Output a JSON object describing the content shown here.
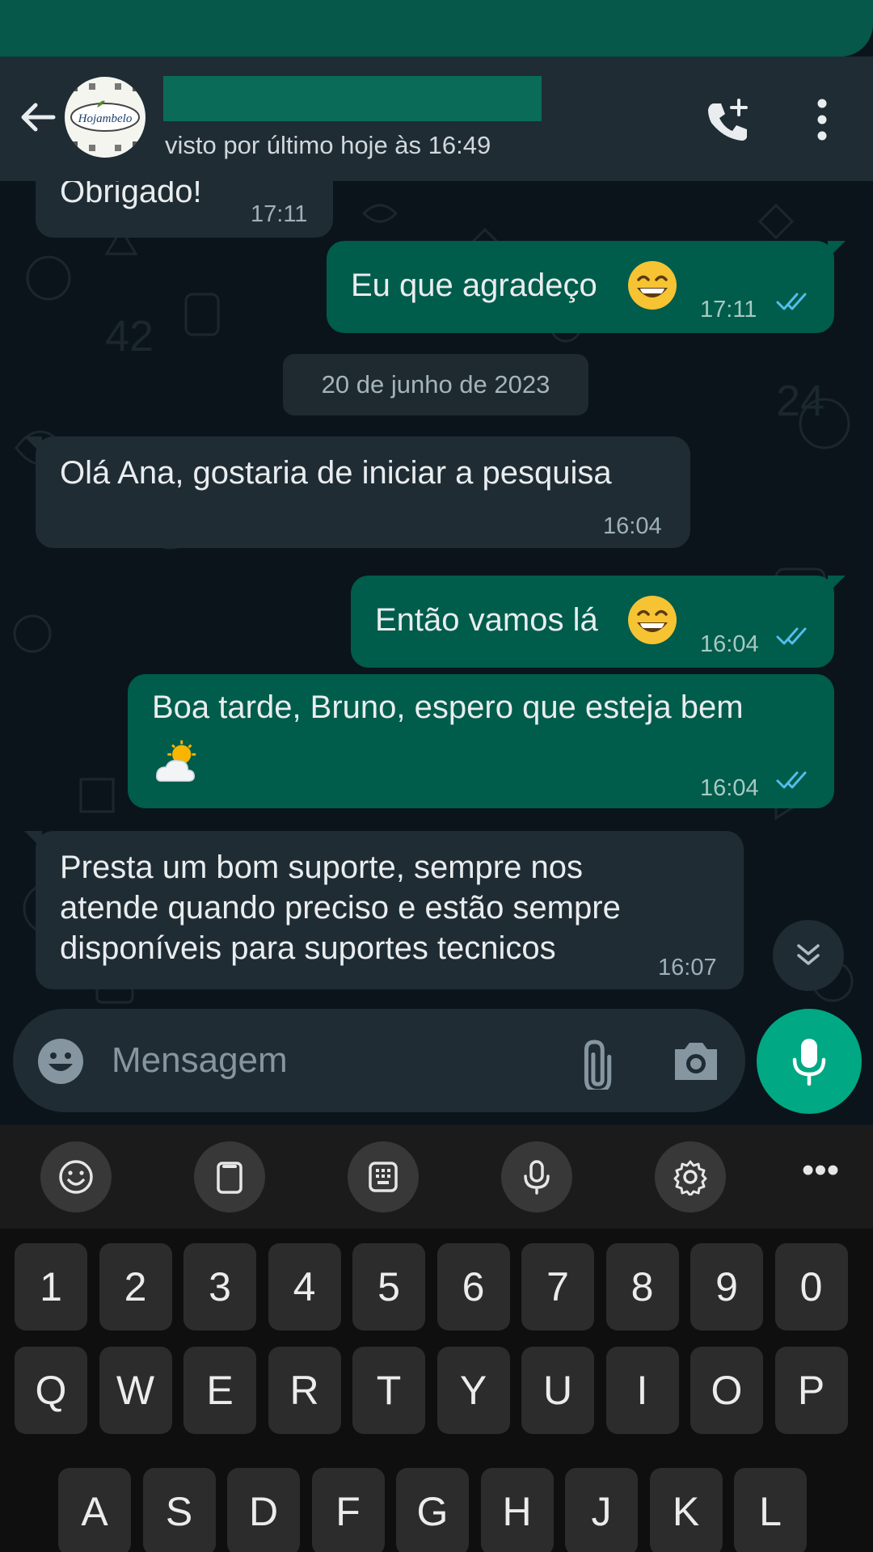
{
  "header": {
    "status": "visto por último hoje às 16:49",
    "avatar_logo_text": "Hojambelo",
    "icons": {
      "back": "arrow-left-icon",
      "call": "add-call-icon",
      "menu": "more-vert-icon"
    }
  },
  "messages": [
    {
      "direction": "in",
      "text": "Obrigado!",
      "time": "17:11",
      "partially_visible": true
    },
    {
      "direction": "out",
      "text": "Eu que agradeço",
      "emoji": "grinning-face",
      "time": "17:11",
      "read": true
    },
    {
      "direction": "in",
      "text": "Olá Ana, gostaria de iniciar a pesquisa",
      "time": "16:04"
    },
    {
      "direction": "out",
      "text": "Então vamos lá",
      "emoji": "grinning-face",
      "time": "16:04",
      "read": true
    },
    {
      "direction": "out",
      "text": "Boa tarde, Bruno, espero que esteja bem",
      "emoji": "sun-behind-cloud",
      "time": "16:04",
      "read": true
    },
    {
      "direction": "in",
      "lines": [
        "Presta um bom suporte, sempre nos",
        "atende quando preciso e estão sempre",
        "disponíveis para suportes tecnicos"
      ],
      "time": "16:07"
    }
  ],
  "date_divider": "20 de junho de 2023",
  "composer": {
    "placeholder": "Mensagem"
  },
  "keyboard": {
    "toolbar": [
      "emoji-icon",
      "clipboard-icon",
      "keypad-icon",
      "mic-icon",
      "settings-icon",
      "more-icon"
    ],
    "more_label": "•••",
    "number_row": [
      "1",
      "2",
      "3",
      "4",
      "5",
      "6",
      "7",
      "8",
      "9",
      "0"
    ],
    "row_q": [
      "Q",
      "W",
      "E",
      "R",
      "T",
      "Y",
      "U",
      "I",
      "O",
      "P"
    ],
    "row_a": [
      "A",
      "S",
      "D",
      "F",
      "G",
      "H",
      "J",
      "K",
      "L"
    ]
  },
  "colors": {
    "header_bg": "#1f2c34",
    "chat_bg": "#0b141a",
    "incoming_bubble": "#202c33",
    "outgoing_bubble": "#005c4b",
    "accent": "#00a884",
    "read_ticks": "#53bdeb"
  }
}
